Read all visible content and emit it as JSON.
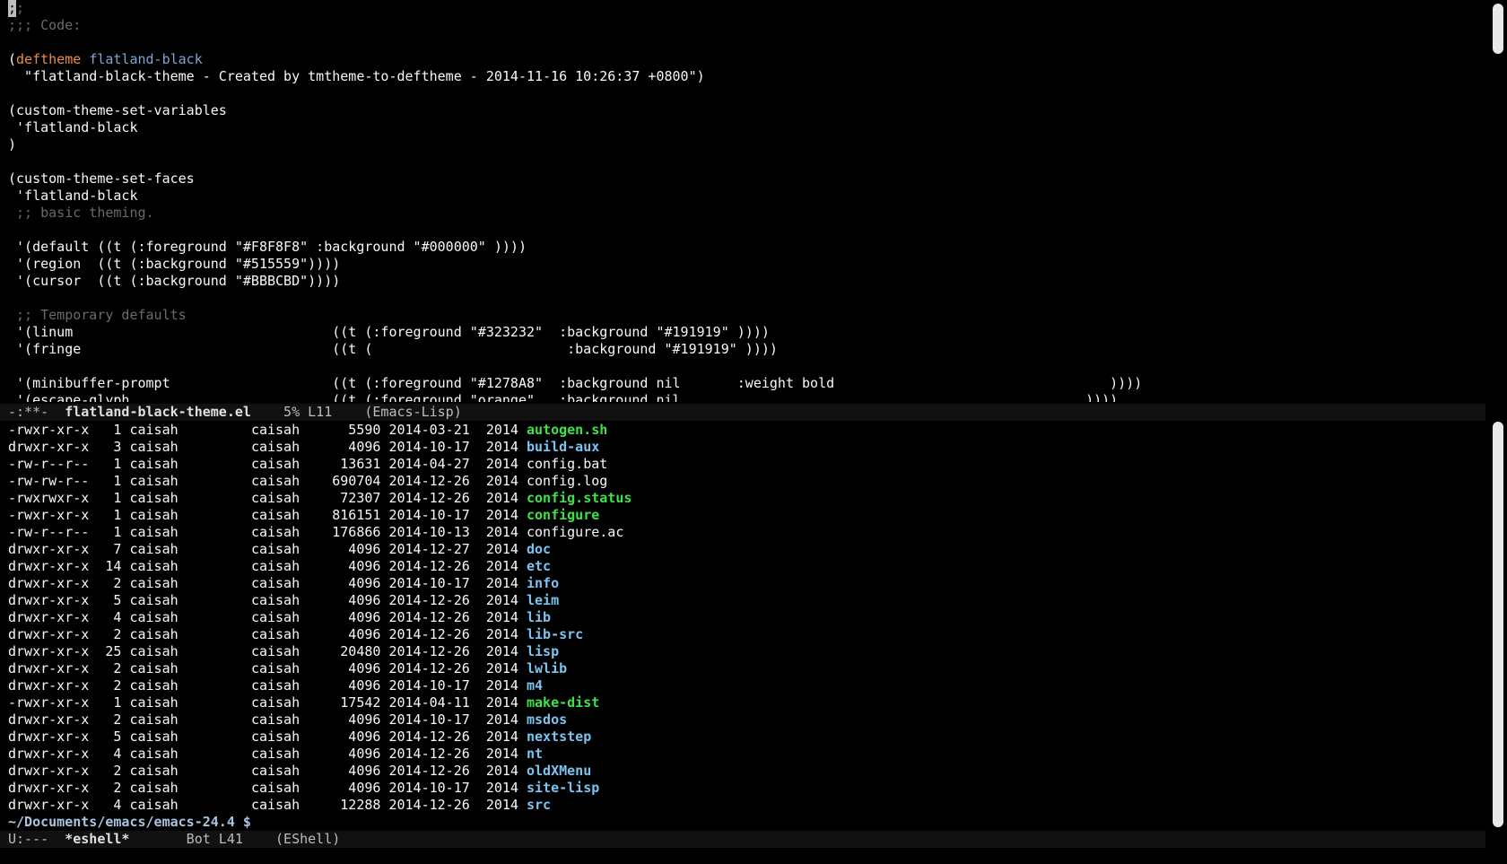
{
  "editor": {
    "code_lines": [
      {
        "segments": [
          {
            "t": ";",
            "k": "cursor"
          },
          {
            "t": ";",
            "k": "comment"
          }
        ]
      },
      {
        "segments": [
          {
            "t": ";;; Code:",
            "k": "comment"
          }
        ]
      },
      {
        "segments": [
          {
            "t": "",
            "k": "text"
          }
        ]
      },
      {
        "segments": [
          {
            "t": "(",
            "k": "text"
          },
          {
            "t": "deftheme",
            "k": "keyword"
          },
          {
            "t": " ",
            "k": "text"
          },
          {
            "t": "flatland-black",
            "k": "fname"
          }
        ]
      },
      {
        "segments": [
          {
            "t": "  \"flatland-black-theme - Created by tmtheme-to-deftheme - 2014-11-16 10:26:37 +0800\")",
            "k": "text"
          }
        ]
      },
      {
        "segments": [
          {
            "t": "",
            "k": "text"
          }
        ]
      },
      {
        "segments": [
          {
            "t": "(custom-theme-set-variables",
            "k": "text"
          }
        ]
      },
      {
        "segments": [
          {
            "t": " 'flatland-black",
            "k": "text"
          }
        ]
      },
      {
        "segments": [
          {
            "t": ")",
            "k": "text"
          }
        ]
      },
      {
        "segments": [
          {
            "t": "",
            "k": "text"
          }
        ]
      },
      {
        "segments": [
          {
            "t": "(custom-theme-set-faces",
            "k": "text"
          }
        ]
      },
      {
        "segments": [
          {
            "t": " 'flatland-black",
            "k": "text"
          }
        ]
      },
      {
        "segments": [
          {
            "t": " ;; basic theming.",
            "k": "comment"
          }
        ]
      },
      {
        "segments": [
          {
            "t": "",
            "k": "text"
          }
        ]
      },
      {
        "segments": [
          {
            "t": " '(default ((t (:foreground \"#F8F8F8\" :background \"#000000\" ))))",
            "k": "text"
          }
        ]
      },
      {
        "segments": [
          {
            "t": " '(region  ((t (:background \"#515559\"))))",
            "k": "text"
          }
        ]
      },
      {
        "segments": [
          {
            "t": " '(cursor  ((t (:background \"#BBBCBD\"))))",
            "k": "text"
          }
        ]
      },
      {
        "segments": [
          {
            "t": "",
            "k": "text"
          }
        ]
      },
      {
        "segments": [
          {
            "t": " ;; Temporary defaults",
            "k": "comment"
          }
        ]
      },
      {
        "segments": [
          {
            "t": " '(linum                                ((t (:foreground \"#323232\"  :background \"#191919\" ))))",
            "k": "text"
          }
        ]
      },
      {
        "segments": [
          {
            "t": " '(fringe                               ((t (                        :background \"#191919\" ))))",
            "k": "text"
          }
        ]
      },
      {
        "segments": [
          {
            "t": "",
            "k": "text"
          }
        ]
      },
      {
        "segments": [
          {
            "t": " '(minibuffer-prompt                    ((t (:foreground \"#1278A8\"  :background nil       :weight bold                                  ))))",
            "k": "text"
          }
        ]
      },
      {
        "segments": [
          {
            "t": " '(escape-glyph                         ((t (:foreground \"orange\"   :background nil                                                  ))))",
            "k": "text"
          }
        ]
      }
    ]
  },
  "modeline_top": {
    "status": "-:**-  ",
    "buffer": "flatland-black-theme.el",
    "position": "    5% L11    ",
    "mode": "(Emacs-Lisp)"
  },
  "eshell": {
    "rows": [
      {
        "perm": "-rwxr-xr-x",
        "links": "1",
        "user": "caisah",
        "group": "caisah",
        "size": "5590",
        "date": "2014-03-21",
        "year": "2014",
        "name": "autogen.sh",
        "kind": "exec"
      },
      {
        "perm": "drwxr-xr-x",
        "links": "3",
        "user": "caisah",
        "group": "caisah",
        "size": "4096",
        "date": "2014-10-17",
        "year": "2014",
        "name": "build-aux",
        "kind": "dir"
      },
      {
        "perm": "-rw-r--r--",
        "links": "1",
        "user": "caisah",
        "group": "caisah",
        "size": "13631",
        "date": "2014-04-27",
        "year": "2014",
        "name": "config.bat",
        "kind": "file"
      },
      {
        "perm": "-rw-rw-r--",
        "links": "1",
        "user": "caisah",
        "group": "caisah",
        "size": "690704",
        "date": "2014-12-26",
        "year": "2014",
        "name": "config.log",
        "kind": "file"
      },
      {
        "perm": "-rwxrwxr-x",
        "links": "1",
        "user": "caisah",
        "group": "caisah",
        "size": "72307",
        "date": "2014-12-26",
        "year": "2014",
        "name": "config.status",
        "kind": "exec"
      },
      {
        "perm": "-rwxr-xr-x",
        "links": "1",
        "user": "caisah",
        "group": "caisah",
        "size": "816151",
        "date": "2014-10-17",
        "year": "2014",
        "name": "configure",
        "kind": "exec"
      },
      {
        "perm": "-rw-r--r--",
        "links": "1",
        "user": "caisah",
        "group": "caisah",
        "size": "176866",
        "date": "2014-10-13",
        "year": "2014",
        "name": "configure.ac",
        "kind": "file"
      },
      {
        "perm": "drwxr-xr-x",
        "links": "7",
        "user": "caisah",
        "group": "caisah",
        "size": "4096",
        "date": "2014-12-27",
        "year": "2014",
        "name": "doc",
        "kind": "dir"
      },
      {
        "perm": "drwxr-xr-x",
        "links": "14",
        "user": "caisah",
        "group": "caisah",
        "size": "4096",
        "date": "2014-12-26",
        "year": "2014",
        "name": "etc",
        "kind": "dir"
      },
      {
        "perm": "drwxr-xr-x",
        "links": "2",
        "user": "caisah",
        "group": "caisah",
        "size": "4096",
        "date": "2014-10-17",
        "year": "2014",
        "name": "info",
        "kind": "dir"
      },
      {
        "perm": "drwxr-xr-x",
        "links": "5",
        "user": "caisah",
        "group": "caisah",
        "size": "4096",
        "date": "2014-12-26",
        "year": "2014",
        "name": "leim",
        "kind": "dir"
      },
      {
        "perm": "drwxr-xr-x",
        "links": "4",
        "user": "caisah",
        "group": "caisah",
        "size": "4096",
        "date": "2014-12-26",
        "year": "2014",
        "name": "lib",
        "kind": "dir"
      },
      {
        "perm": "drwxr-xr-x",
        "links": "2",
        "user": "caisah",
        "group": "caisah",
        "size": "4096",
        "date": "2014-12-26",
        "year": "2014",
        "name": "lib-src",
        "kind": "dir"
      },
      {
        "perm": "drwxr-xr-x",
        "links": "25",
        "user": "caisah",
        "group": "caisah",
        "size": "20480",
        "date": "2014-12-26",
        "year": "2014",
        "name": "lisp",
        "kind": "dir"
      },
      {
        "perm": "drwxr-xr-x",
        "links": "2",
        "user": "caisah",
        "group": "caisah",
        "size": "4096",
        "date": "2014-12-26",
        "year": "2014",
        "name": "lwlib",
        "kind": "dir"
      },
      {
        "perm": "drwxr-xr-x",
        "links": "2",
        "user": "caisah",
        "group": "caisah",
        "size": "4096",
        "date": "2014-10-17",
        "year": "2014",
        "name": "m4",
        "kind": "dir"
      },
      {
        "perm": "-rwxr-xr-x",
        "links": "1",
        "user": "caisah",
        "group": "caisah",
        "size": "17542",
        "date": "2014-04-11",
        "year": "2014",
        "name": "make-dist",
        "kind": "exec"
      },
      {
        "perm": "drwxr-xr-x",
        "links": "2",
        "user": "caisah",
        "group": "caisah",
        "size": "4096",
        "date": "2014-10-17",
        "year": "2014",
        "name": "msdos",
        "kind": "dir"
      },
      {
        "perm": "drwxr-xr-x",
        "links": "5",
        "user": "caisah",
        "group": "caisah",
        "size": "4096",
        "date": "2014-12-26",
        "year": "2014",
        "name": "nextstep",
        "kind": "dir"
      },
      {
        "perm": "drwxr-xr-x",
        "links": "4",
        "user": "caisah",
        "group": "caisah",
        "size": "4096",
        "date": "2014-12-26",
        "year": "2014",
        "name": "nt",
        "kind": "dir"
      },
      {
        "perm": "drwxr-xr-x",
        "links": "2",
        "user": "caisah",
        "group": "caisah",
        "size": "4096",
        "date": "2014-12-26",
        "year": "2014",
        "name": "oldXMenu",
        "kind": "dir"
      },
      {
        "perm": "drwxr-xr-x",
        "links": "2",
        "user": "caisah",
        "group": "caisah",
        "size": "4096",
        "date": "2014-10-17",
        "year": "2014",
        "name": "site-lisp",
        "kind": "dir"
      },
      {
        "perm": "drwxr-xr-x",
        "links": "4",
        "user": "caisah",
        "group": "caisah",
        "size": "12288",
        "date": "2014-12-26",
        "year": "2014",
        "name": "src",
        "kind": "dir"
      }
    ],
    "prompt": "~/Documents/emacs/emacs-24.4 $"
  },
  "modeline_bottom": {
    "status": "U:---  ",
    "buffer": "*eshell*",
    "position": "       Bot L41    ",
    "mode": "(EShell)"
  },
  "colors": {
    "background": "#000000",
    "foreground": "#F8F8F8",
    "comment": "#6a6a6a",
    "keyword": "#EC8D45",
    "function_name": "#7FA6D4",
    "executable": "#3FE04A",
    "directory": "#7CC3F0",
    "modeline_bg": "#111111",
    "cursor": "#BBBCBD"
  }
}
